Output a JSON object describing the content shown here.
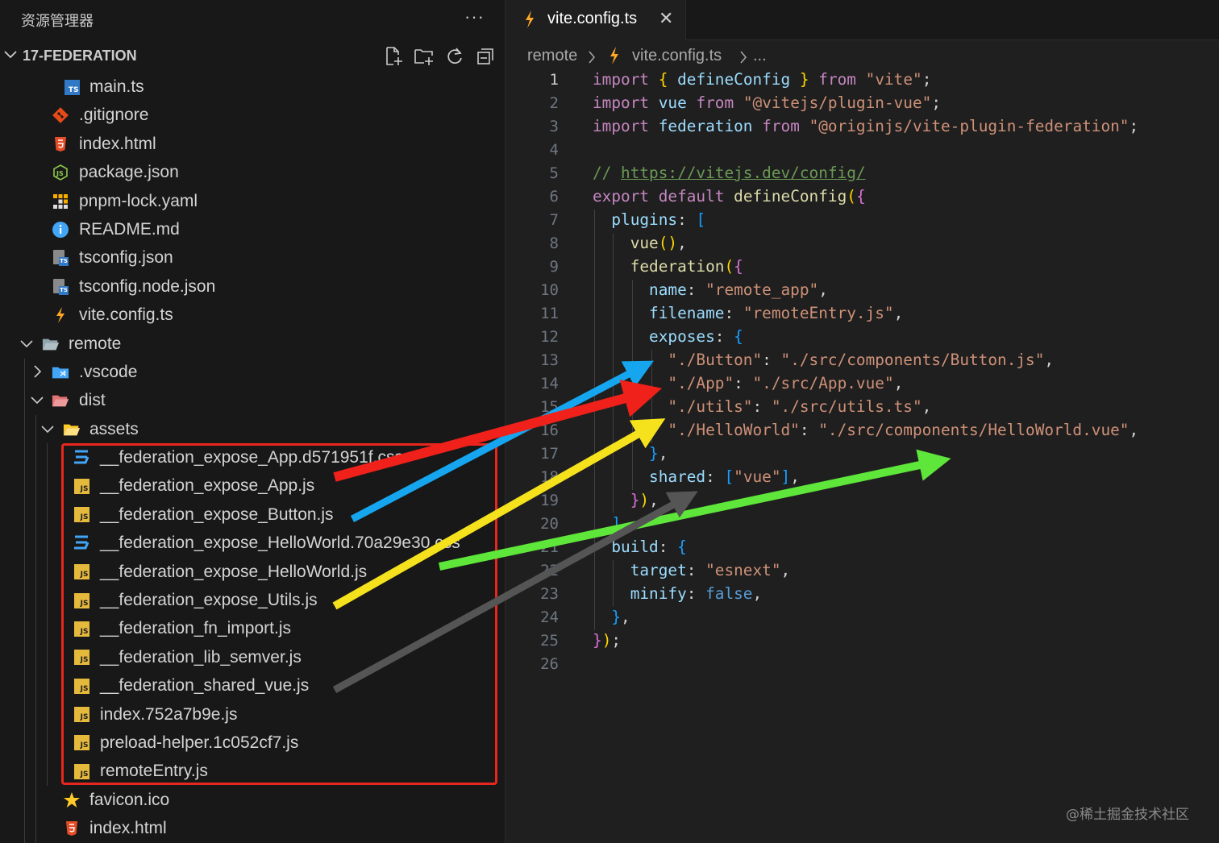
{
  "explorer": {
    "title": "资源管理器",
    "more": "···",
    "project": "17-FEDERATION",
    "tools": [
      "new-file-icon",
      "new-folder-icon",
      "refresh-icon",
      "collapse-all-icon"
    ],
    "tree": [
      {
        "name": "main.ts",
        "icon": "typescript-icon"
      },
      {
        "name": ".gitignore",
        "icon": "git-icon"
      },
      {
        "name": "index.html",
        "icon": "html-icon"
      },
      {
        "name": "package.json",
        "icon": "nodejs-icon"
      },
      {
        "name": "pnpm-lock.yaml",
        "icon": "pnpm-icon"
      },
      {
        "name": "README.md",
        "icon": "info-icon"
      },
      {
        "name": "tsconfig.json",
        "icon": "tsconfig-icon"
      },
      {
        "name": "tsconfig.node.json",
        "icon": "tsconfig-icon"
      },
      {
        "name": "vite.config.ts",
        "icon": "vite-icon"
      },
      {
        "name": "remote",
        "icon": "folder-open-icon"
      },
      {
        "name": ".vscode",
        "icon": "vscode-folder-icon"
      },
      {
        "name": "dist",
        "icon": "dist-folder-icon"
      },
      {
        "name": "assets",
        "icon": "assets-folder-icon"
      },
      {
        "name": "__federation_expose_App.d571951f.css",
        "icon": "css-icon"
      },
      {
        "name": "__federation_expose_App.js",
        "icon": "js-icon"
      },
      {
        "name": "__federation_expose_Button.js",
        "icon": "js-icon"
      },
      {
        "name": "__federation_expose_HelloWorld.70a29e30.css",
        "icon": "css-icon"
      },
      {
        "name": "__federation_expose_HelloWorld.js",
        "icon": "js-icon"
      },
      {
        "name": "__federation_expose_Utils.js",
        "icon": "js-icon"
      },
      {
        "name": "__federation_fn_import.js",
        "icon": "js-icon"
      },
      {
        "name": "__federation_lib_semver.js",
        "icon": "js-icon"
      },
      {
        "name": "__federation_shared_vue.js",
        "icon": "js-icon"
      },
      {
        "name": "index.752a7b9e.js",
        "icon": "js-icon"
      },
      {
        "name": "preload-helper.1c052cf7.js",
        "icon": "js-icon"
      },
      {
        "name": "remoteEntry.js",
        "icon": "js-icon"
      },
      {
        "name": "favicon.ico",
        "icon": "star-icon"
      },
      {
        "name": "index.html",
        "icon": "html-icon"
      }
    ]
  },
  "editor": {
    "tab": {
      "label": "vite.config.ts",
      "close": "✕"
    },
    "breadcrumb": {
      "folder": "remote",
      "file": "vite.config.ts",
      "more": "..."
    },
    "line_numbers": [
      "1",
      "2",
      "3",
      "4",
      "5",
      "6",
      "7",
      "8",
      "9",
      "10",
      "11",
      "12",
      "13",
      "14",
      "15",
      "16",
      "17",
      "18",
      "19",
      "20",
      "21",
      "22",
      "23",
      "24",
      "25",
      "26"
    ],
    "code": {
      "import": "import",
      "from": "from",
      "export": "export",
      "default": "default",
      "defineConfig": "defineConfig",
      "vue": "vue",
      "federation": "federation",
      "vite_str": "\"vite\"",
      "vue_plugin_str": "\"@vitejs/plugin-vue\"",
      "federation_plugin_str": "\"@originjs/vite-plugin-federation\"",
      "comment_prefix": "// ",
      "comment_url": "https://vitejs.dev/config/",
      "plugins": "plugins",
      "name_key": "name",
      "name_val": "\"remote_app\"",
      "filename_key": "filename",
      "filename_val": "\"remoteEntry.js\"",
      "exposes_key": "exposes",
      "expose_button_key": "\"./Button\"",
      "expose_button_val": "\"./src/components/Button.js\"",
      "expose_app_key": "\"./App\"",
      "expose_app_val": "\"./src/App.vue\"",
      "expose_utils_key": "\"./utils\"",
      "expose_utils_val": "\"./src/utils.ts\"",
      "expose_hello_key": "\"./HelloWorld\"",
      "expose_hello_val": "\"./src/components/HelloWorld.vue\"",
      "shared_key": "shared",
      "shared_val": "\"vue\"",
      "build_key": "build",
      "target_key": "target",
      "target_val": "\"esnext\"",
      "minify_key": "minify",
      "minify_val": "false"
    }
  },
  "annotations": {
    "arrow_colors": {
      "app": "#f0201a",
      "button": "#16a6f0",
      "utils": "#f5e21d",
      "helloworld": "#5ee63a",
      "shared": "#555555"
    },
    "box_color": "#e8261d"
  },
  "watermark": "@稀土掘金技术社区"
}
